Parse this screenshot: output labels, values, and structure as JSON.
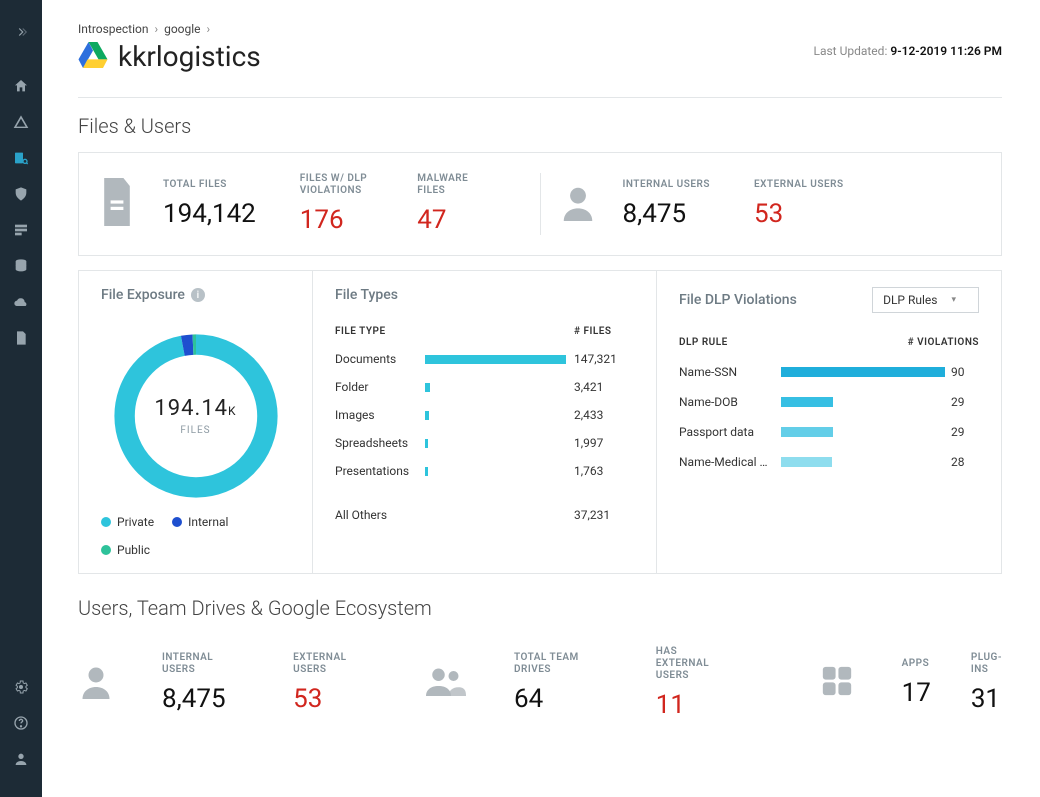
{
  "breadcrumb": {
    "level1": "Introspection",
    "level2": "google"
  },
  "page_title": "kkrlogistics",
  "last_updated": {
    "label": "Last Updated:",
    "value": "9-12-2019 11:26 PM"
  },
  "section_files_users_title": "Files & Users",
  "files_users_metrics": {
    "total_files": {
      "label": "TOTAL FILES",
      "value": "194,142"
    },
    "dlp_violations": {
      "label": "FILES W/ DLP VIOLATIONS",
      "value": "176"
    },
    "malware": {
      "label": "MALWARE FILES",
      "value": "47"
    },
    "internal_users": {
      "label": "INTERNAL USERS",
      "value": "8,475"
    },
    "external_users": {
      "label": "EXTERNAL USERS",
      "value": "53"
    }
  },
  "file_exposure": {
    "title": "File Exposure",
    "center_value": "194.14",
    "center_suffix": "K",
    "center_sub": "FILES",
    "legend": [
      {
        "label": "Private",
        "color": "#2ec4dc"
      },
      {
        "label": "Internal",
        "color": "#1e4fcf"
      },
      {
        "label": "Public",
        "color": "#2ec29a"
      }
    ]
  },
  "file_types": {
    "title": "File Types",
    "header_type": "FILE TYPE",
    "header_files": "# FILES",
    "rows": [
      {
        "name": "Documents",
        "count": "147,321",
        "pct": 100
      },
      {
        "name": "Folder",
        "count": "3,421",
        "pct": 3.5
      },
      {
        "name": "Images",
        "count": "2,433",
        "pct": 3
      },
      {
        "name": "Spreadsheets",
        "count": "1,997",
        "pct": 2.2
      },
      {
        "name": "Presentations",
        "count": "1,763",
        "pct": 2.1
      },
      {
        "name": "All Others",
        "count": "37,231",
        "pct": 0
      }
    ]
  },
  "dlp_panel": {
    "title": "File DLP Violations",
    "select_value": "DLP Rules",
    "header_rule": "DLP RULE",
    "header_viol": "# VIOLATIONS",
    "rows": [
      {
        "name": "Name-SSN",
        "count": "90",
        "pct": 100,
        "color": "#1faedb"
      },
      {
        "name": "Name-DOB",
        "count": "29",
        "pct": 32,
        "color": "#36bfe3"
      },
      {
        "name": "Passport data",
        "count": "29",
        "pct": 32,
        "color": "#63cee8"
      },
      {
        "name": "Name-Medical C...",
        "count": "28",
        "pct": 31,
        "color": "#8eddee"
      }
    ]
  },
  "section_users_title": "Users, Team Drives & Google Ecosystem",
  "bottom": {
    "internal_users": {
      "label": "INTERNAL USERS",
      "value": "8,475"
    },
    "external_users": {
      "label": "EXTERNAL USERS",
      "value": "53"
    },
    "total_team_drives": {
      "label": "TOTAL TEAM DRIVES",
      "value": "64"
    },
    "has_external_users": {
      "label": "HAS EXTERNAL USERS",
      "value": "11"
    },
    "apps": {
      "label": "APPS",
      "value": "17"
    },
    "plugins": {
      "label": "PLUG-INS",
      "value": "31"
    }
  },
  "chart_data": [
    {
      "type": "pie",
      "title": "File Exposure",
      "total_label": "194.14K FILES",
      "series": [
        {
          "name": "Private",
          "value": 97,
          "color": "#2ec4dc"
        },
        {
          "name": "Internal",
          "value": 2,
          "color": "#1e4fcf"
        },
        {
          "name": "Public",
          "value": 1,
          "color": "#2ec29a"
        }
      ]
    },
    {
      "type": "bar",
      "title": "File Types",
      "categories": [
        "Documents",
        "Folder",
        "Images",
        "Spreadsheets",
        "Presentations",
        "All Others"
      ],
      "values": [
        147321,
        3421,
        2433,
        1997,
        1763,
        37231
      ],
      "xlabel": "# FILES",
      "ylabel": "FILE TYPE"
    },
    {
      "type": "bar",
      "title": "File DLP Violations",
      "categories": [
        "Name-SSN",
        "Name-DOB",
        "Passport data",
        "Name-Medical C..."
      ],
      "values": [
        90,
        29,
        29,
        28
      ],
      "xlabel": "# VIOLATIONS",
      "ylabel": "DLP RULE"
    }
  ]
}
